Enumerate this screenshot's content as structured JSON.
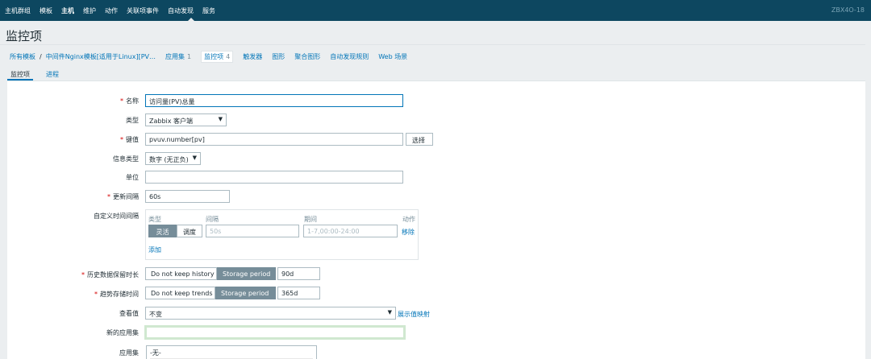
{
  "topnav": {
    "items": [
      "主机群组",
      "模板",
      "主机",
      "维护",
      "动作",
      "关联项事件",
      "自动发现",
      "服务"
    ],
    "active_index": 2,
    "server_name": "ZBX4O-18"
  },
  "page_title": "监控项",
  "breadcrumb": {
    "all_templates": "所有模板",
    "separator": "/",
    "template": "中间件Nginx模板[适用于Linux][PV…",
    "items": [
      {
        "label": "应用集",
        "count": "1"
      },
      {
        "label": "监控项",
        "count": "4"
      },
      {
        "label": "触发器",
        "count": ""
      },
      {
        "label": "图形",
        "count": ""
      },
      {
        "label": "聚合图形",
        "count": ""
      },
      {
        "label": "自动发现规则",
        "count": ""
      },
      {
        "label": "Web 场景",
        "count": ""
      }
    ]
  },
  "tabs": [
    "监控项",
    "进程"
  ],
  "form": {
    "name": {
      "label": "名称",
      "value": "访问量(PV)总量"
    },
    "type": {
      "label": "类型",
      "value": "Zabbix 客户端"
    },
    "key": {
      "label": "键值",
      "value": "pvuv.number[pv]",
      "select_button": "选择"
    },
    "info_type": {
      "label": "信息类型",
      "value": "数字 (无正负)"
    },
    "units": {
      "label": "单位",
      "value": ""
    },
    "update_interval": {
      "label": "更新间隔",
      "value": "60s"
    },
    "custom_intervals": {
      "label": "自定义时间间隔",
      "headers": {
        "type": "类型",
        "interval": "间隔",
        "period": "期间",
        "action": "动作"
      },
      "row": {
        "flexible": "灵活",
        "scheduling": "调度",
        "interval_placeholder": "50s",
        "period_placeholder": "1-7,00:00-24:00",
        "remove": "移除"
      },
      "add": "添加"
    },
    "history": {
      "label": "历史数据保留时长",
      "opt1": "Do not keep history",
      "opt2": "Storage period",
      "value": "90d"
    },
    "trends": {
      "label": "趋势存储时间",
      "opt1": "Do not keep trends",
      "opt2": "Storage period",
      "value": "365d"
    },
    "show_value": {
      "label": "查看值",
      "value": "不变",
      "link": "展示值映射"
    },
    "new_application": {
      "label": "新的应用集",
      "value": ""
    },
    "applications": {
      "label": "应用集",
      "option": "-无-"
    }
  }
}
